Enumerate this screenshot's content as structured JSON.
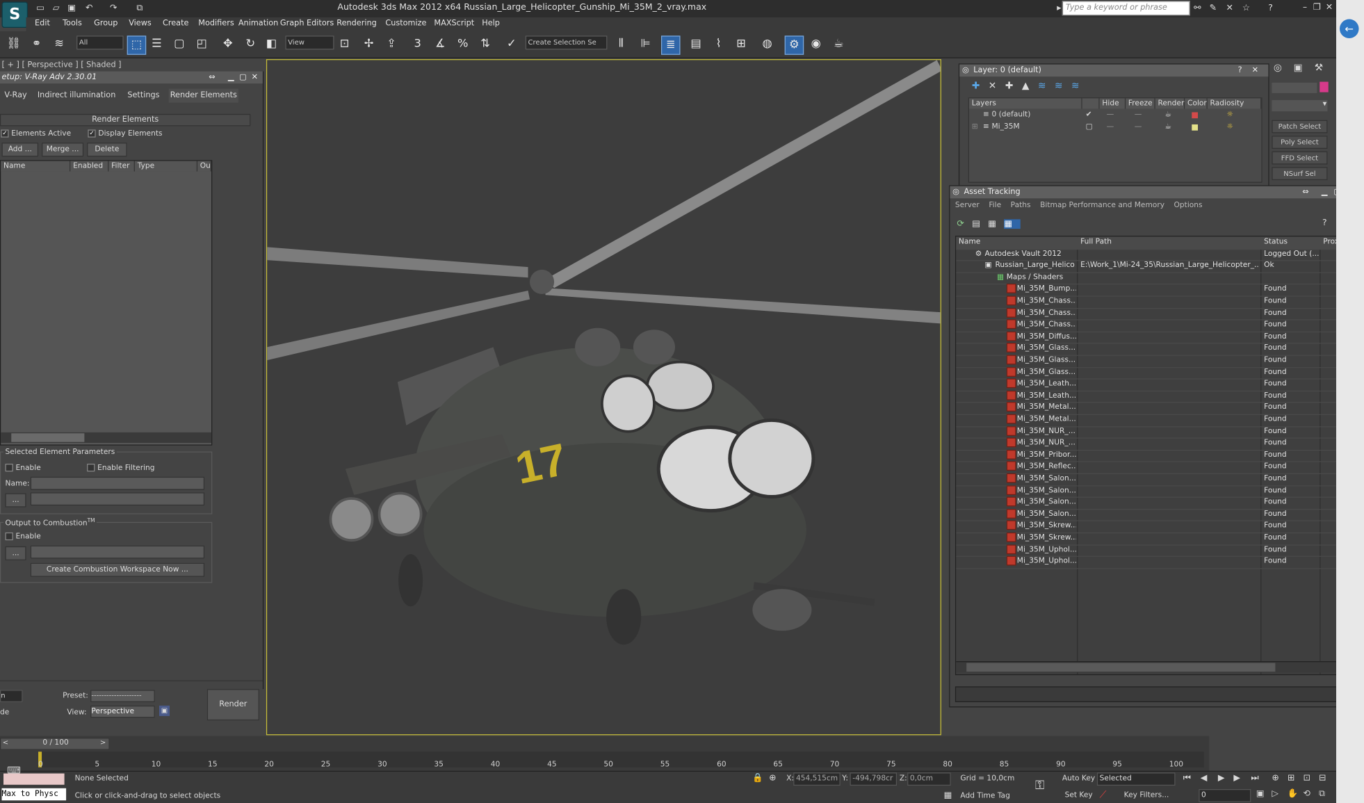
{
  "app": {
    "title": "Autodesk 3ds Max  2012 x64     Russian_Large_Helicopter_Gunship_Mi_35M_2_vray.max",
    "search_placeholder": "Type a keyword or phrase",
    "logo": "S"
  },
  "menu": [
    "Edit",
    "Tools",
    "Group",
    "Views",
    "Create",
    "Modifiers",
    "Animation",
    "Graph Editors",
    "Rendering",
    "Customize",
    "MAXScript",
    "Help"
  ],
  "toolbar": {
    "filter_value": "All",
    "ref_coord_value": "View",
    "selection_set_value": "Create Selection Se",
    "snap_3": "3"
  },
  "viewport": {
    "label": "[ + ] [ Perspective ] [ Shaded ]"
  },
  "render_setup": {
    "title": "etup: V-Ray Adv 2.30.01",
    "tabs": [
      "V-Ray",
      "Indirect illumination",
      "Settings",
      "Render Elements"
    ],
    "rollout_title": "Render Elements",
    "elements_active": "Elements Active",
    "display_elements": "Display Elements",
    "add_btn": "Add ...",
    "merge_btn": "Merge ...",
    "delete_btn": "Delete",
    "list_columns": [
      "Name",
      "Enabled",
      "Filter",
      "Type",
      "Ou"
    ],
    "selected_params_title": "Selected Element Parameters",
    "enable_label": "Enable",
    "enable_filtering": "Enable Filtering",
    "name_label": "Name:",
    "browse_btn": "...",
    "output_combustion": "Output to Combustion",
    "tm": "TM",
    "enable2": "Enable",
    "browse_btn2": "...",
    "create_combustion": "Create Combustion Workspace Now ...",
    "preset_label": "Preset:",
    "preset_value": "--------------------",
    "view_label": "View:",
    "view_value": "Perspective",
    "render_btn": "Render",
    "mode_frag": "n",
    "mode_frag2": "de"
  },
  "layer_dialog": {
    "title": "Layer: 0 (default)",
    "columns": [
      "Layers",
      "Hide",
      "Freeze",
      "Render",
      "Color",
      "Radiosity"
    ],
    "rows": [
      {
        "name": "0 (default)",
        "color": "#d44a4a",
        "active": "✔"
      },
      {
        "name": "Mi_35M",
        "color": "#e4e28a",
        "active": "▢"
      }
    ]
  },
  "asset_tracking": {
    "title": "Asset Tracking",
    "menu": [
      "Server",
      "File",
      "Paths",
      "Bitmap Performance and Memory",
      "Options"
    ],
    "columns": [
      "Name",
      "Full Path",
      "Status",
      "Proxy Re"
    ],
    "vault": {
      "name": "Autodesk Vault 2012",
      "status": "Logged Out (..."
    },
    "scene": {
      "name": "Russian_Large_Helico...",
      "path": "E:\\Work_1\\Mi-24_35\\Russian_Large_Helicopter_...",
      "status": "Ok"
    },
    "maps_group": "Maps / Shaders",
    "maps": [
      {
        "name": "Mi_35M_Bump....",
        "status": "Found"
      },
      {
        "name": "Mi_35M_Chass...",
        "status": "Found"
      },
      {
        "name": "Mi_35M_Chass...",
        "status": "Found"
      },
      {
        "name": "Mi_35M_Chass...",
        "status": "Found"
      },
      {
        "name": "Mi_35M_Diffus...",
        "status": "Found"
      },
      {
        "name": "Mi_35M_Glass...",
        "status": "Found"
      },
      {
        "name": "Mi_35M_Glass...",
        "status": "Found"
      },
      {
        "name": "Mi_35M_Glass...",
        "status": "Found"
      },
      {
        "name": "Mi_35M_Leath...",
        "status": "Found"
      },
      {
        "name": "Mi_35M_Leath...",
        "status": "Found"
      },
      {
        "name": "Mi_35M_Metal...",
        "status": "Found"
      },
      {
        "name": "Mi_35M_Metal...",
        "status": "Found"
      },
      {
        "name": "Mi_35M_NUR_...",
        "status": "Found"
      },
      {
        "name": "Mi_35M_NUR_...",
        "status": "Found"
      },
      {
        "name": "Mi_35M_Pribor...",
        "status": "Found"
      },
      {
        "name": "Mi_35M_Reflec...",
        "status": "Found"
      },
      {
        "name": "Mi_35M_Salon...",
        "status": "Found"
      },
      {
        "name": "Mi_35M_Salon...",
        "status": "Found"
      },
      {
        "name": "Mi_35M_Salon...",
        "status": "Found"
      },
      {
        "name": "Mi_35M_Salon...",
        "status": "Found"
      },
      {
        "name": "Mi_35M_Skrew...",
        "status": "Found"
      },
      {
        "name": "Mi_35M_Skrew...",
        "status": "Found"
      },
      {
        "name": "Mi_35M_Uphol...",
        "status": "Found"
      },
      {
        "name": "Mi_35M_Uphol...",
        "status": "Found"
      }
    ]
  },
  "command_panel": {
    "buttons": [
      "Patch Select",
      "Poly Select",
      "FFD Select",
      "NSurf Sel"
    ],
    "color": "#d63a8a"
  },
  "timeline": {
    "frame_counter": "0 / 100",
    "ticks": [
      "0",
      "5",
      "10",
      "15",
      "20",
      "25",
      "30",
      "35",
      "40",
      "45",
      "50",
      "55",
      "60",
      "65",
      "70",
      "75",
      "80",
      "85",
      "90",
      "95",
      "100"
    ]
  },
  "status": {
    "maxscript": "Max to Physc",
    "selection": "None Selected",
    "prompt": "Click or click-and-drag to select objects",
    "x_label": "X:",
    "x_value": "454,515cm",
    "y_label": "Y:",
    "y_value": "-494,798cr",
    "z_label": "Z:",
    "z_value": "0,0cm",
    "grid": "Grid = 10,0cm",
    "add_time_tag": "Add Time Tag",
    "auto_key": "Auto Key",
    "selected_value": "Selected",
    "set_key": "Set Key",
    "key_filters": "Key Filters...",
    "frame_value": "0"
  }
}
